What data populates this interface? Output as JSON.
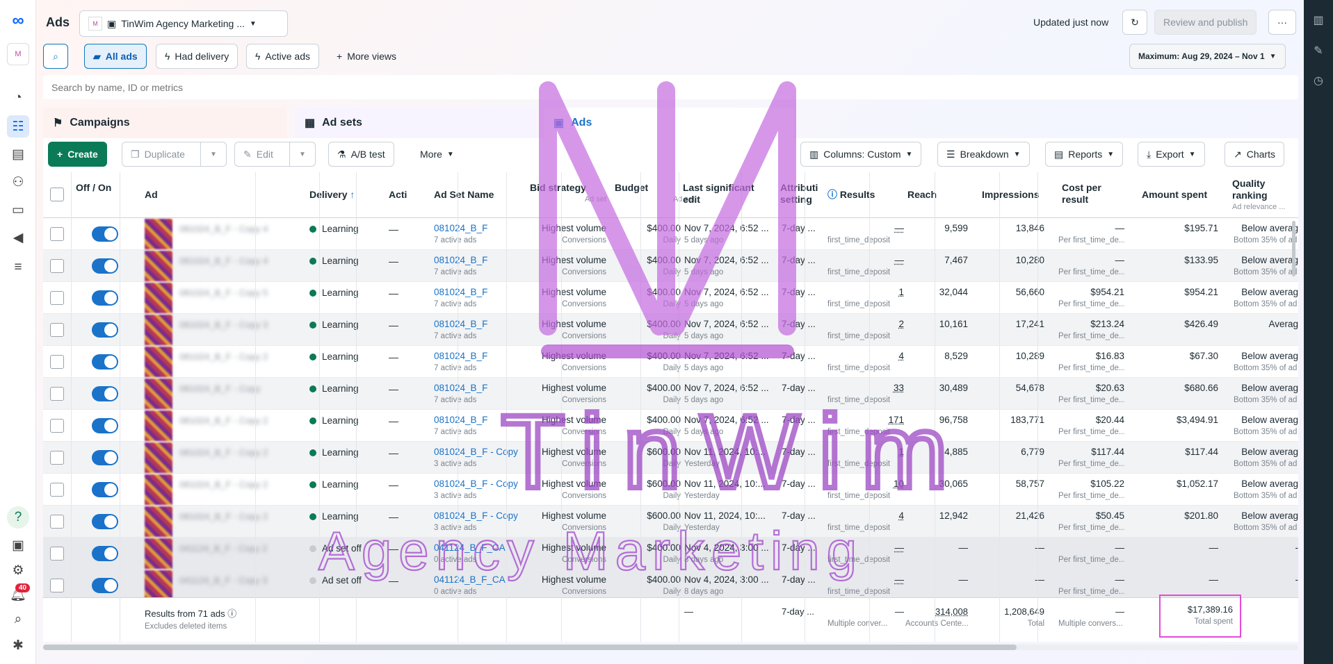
{
  "app": {
    "title": "Ads",
    "account": "TinWim Agency Marketing ...",
    "updated": "Updated just now",
    "review": "Review and publish",
    "more": "···"
  },
  "nav": {
    "notifications": "40"
  },
  "filters": {
    "all_ads": "All ads",
    "had_delivery": "Had delivery",
    "active_ads": "Active ads",
    "more_views": "More views",
    "date_range": "Maximum: Aug 29, 2024 – Nov 1"
  },
  "search": {
    "placeholder": "Search by name, ID or metrics"
  },
  "tabs": {
    "campaigns": "Campaigns",
    "adsets": "Ad sets",
    "ads": "Ads"
  },
  "toolbar": {
    "create": "Create",
    "duplicate": "Duplicate",
    "edit": "Edit",
    "abtest": "A/B test",
    "more": "More",
    "columns": "Columns: Custom",
    "breakdown": "Breakdown",
    "reports": "Reports",
    "export": "Export",
    "charts": "Charts"
  },
  "headers": {
    "offon": "Off / On",
    "ad": "Ad",
    "delivery": "Delivery",
    "actions": "Acti",
    "adset": "Ad Set Name",
    "bid": "Bid strategy",
    "bid_sub": "Ad set",
    "budget": "Budget",
    "budget_sub": "Ad set",
    "last_edit": "Last significant edit",
    "attrib": "Attribution setting",
    "results": "Results",
    "reach": "Reach",
    "impressions": "Impressions",
    "cpr": "Cost per result",
    "spent": "Amount spent",
    "quality": "Quality ranking",
    "quality_sub": "Ad relevance ..."
  },
  "rows": [
    {
      "name": "081024_B_F - Copy 4",
      "delivery": "Learning",
      "dstatus": "green",
      "adset": "081024_B_F",
      "adset_sub": "7 active ads",
      "bid": "Highest volume",
      "bid_sub": "Conversions",
      "budget": "$400.00",
      "budget_sub": "Daily",
      "edit": "Nov 7, 2024, 6:52 ...",
      "edit_sub": "5 days ago",
      "attrib": "7-day ...",
      "results": "—",
      "results_sub": "first_time_deposit",
      "reach": "9,599",
      "impr": "13,846",
      "cpr": "—",
      "cpr_sub": "Per first_time_de...",
      "spent": "$195.71",
      "quality": "Below averag",
      "quality_sub": "Bottom 35% of ad"
    },
    {
      "name": "081024_B_F - Copy 4",
      "delivery": "Learning",
      "dstatus": "green",
      "adset": "081024_B_F",
      "adset_sub": "7 active ads",
      "bid": "Highest volume",
      "bid_sub": "Conversions",
      "budget": "$400.00",
      "budget_sub": "Daily",
      "edit": "Nov 7, 2024, 6:52 ...",
      "edit_sub": "5 days ago",
      "attrib": "7-day ...",
      "results": "—",
      "results_sub": "first_time_deposit",
      "reach": "7,467",
      "impr": "10,280",
      "cpr": "—",
      "cpr_sub": "Per first_time_de...",
      "spent": "$133.95",
      "quality": "Below averag",
      "quality_sub": "Bottom 35% of ad"
    },
    {
      "name": "081024_B_F - Copy 5",
      "delivery": "Learning",
      "dstatus": "green",
      "adset": "081024_B_F",
      "adset_sub": "7 active ads",
      "bid": "Highest volume",
      "bid_sub": "Conversions",
      "budget": "$400.00",
      "budget_sub": "Daily",
      "edit": "Nov 7, 2024, 6:52 ...",
      "edit_sub": "5 days ago",
      "attrib": "7-day ...",
      "results": "1",
      "results_sub": "first_time_deposit",
      "reach": "32,044",
      "impr": "56,660",
      "cpr": "$954.21",
      "cpr_sub": "Per first_time_de...",
      "spent": "$954.21",
      "quality": "Below averag",
      "quality_sub": "Bottom 35% of ad"
    },
    {
      "name": "081024_B_F - Copy 3",
      "delivery": "Learning",
      "dstatus": "green",
      "adset": "081024_B_F",
      "adset_sub": "7 active ads",
      "bid": "Highest volume",
      "bid_sub": "Conversions",
      "budget": "$400.00",
      "budget_sub": "Daily",
      "edit": "Nov 7, 2024, 6:52 ...",
      "edit_sub": "5 days ago",
      "attrib": "7-day ...",
      "results": "2",
      "results_sub": "first_time_deposit",
      "reach": "10,161",
      "impr": "17,241",
      "cpr": "$213.24",
      "cpr_sub": "Per first_time_de...",
      "spent": "$426.49",
      "quality": "Averag",
      "quality_sub": ""
    },
    {
      "name": "081024_B_F - Copy 2",
      "delivery": "Learning",
      "dstatus": "green",
      "adset": "081024_B_F",
      "adset_sub": "7 active ads",
      "bid": "Highest volume",
      "bid_sub": "Conversions",
      "budget": "$400.00",
      "budget_sub": "Daily",
      "edit": "Nov 7, 2024, 6:52 ...",
      "edit_sub": "5 days ago",
      "attrib": "7-day ...",
      "results": "4",
      "results_sub": "first_time_deposit",
      "reach": "8,529",
      "impr": "10,289",
      "cpr": "$16.83",
      "cpr_sub": "Per first_time_de...",
      "spent": "$67.30",
      "quality": "Below averag",
      "quality_sub": "Bottom 35% of ad"
    },
    {
      "name": "081024_B_F - Copy",
      "delivery": "Learning",
      "dstatus": "green",
      "adset": "081024_B_F",
      "adset_sub": "7 active ads",
      "bid": "Highest volume",
      "bid_sub": "Conversions",
      "budget": "$400.00",
      "budget_sub": "Daily",
      "edit": "Nov 7, 2024, 6:52 ...",
      "edit_sub": "5 days ago",
      "attrib": "7-day ...",
      "results": "33",
      "results_sub": "first_time_deposit",
      "reach": "30,489",
      "impr": "54,678",
      "cpr": "$20.63",
      "cpr_sub": "Per first_time_de...",
      "spent": "$680.66",
      "quality": "Below averag",
      "quality_sub": "Bottom 35% of ad"
    },
    {
      "name": "081024_B_F - Copy 2",
      "delivery": "Learning",
      "dstatus": "green",
      "adset": "081024_B_F",
      "adset_sub": "7 active ads",
      "bid": "Highest volume",
      "bid_sub": "Conversions",
      "budget": "$400.00",
      "budget_sub": "Daily",
      "edit": "Nov 7, 2024, 6:52 ...",
      "edit_sub": "5 days ago",
      "attrib": "7-day ...",
      "results": "171",
      "results_sub": "first_time_deposit",
      "reach": "96,758",
      "impr": "183,771",
      "cpr": "$20.44",
      "cpr_sub": "Per first_time_de...",
      "spent": "$3,494.91",
      "quality": "Below averag",
      "quality_sub": "Bottom 35% of ad"
    },
    {
      "name": "081024_B_F - Copy 2",
      "delivery": "Learning",
      "dstatus": "green",
      "adset": "081024_B_F - Copy",
      "adset_sub": "3 active ads",
      "bid": "Highest volume",
      "bid_sub": "Conversions",
      "budget": "$600.00",
      "budget_sub": "Daily",
      "edit": "Nov 11, 2024, 10:...",
      "edit_sub": "Yesterday",
      "attrib": "7-day ...",
      "results": "1",
      "results_sub": "first_time_deposit",
      "reach": "4,885",
      "impr": "6,779",
      "cpr": "$117.44",
      "cpr_sub": "Per first_time_de...",
      "spent": "$117.44",
      "quality": "Below averag",
      "quality_sub": "Bottom 35% of ad"
    },
    {
      "name": "081024_B_F - Copy 2",
      "delivery": "Learning",
      "dstatus": "green",
      "adset": "081024_B_F - Copy",
      "adset_sub": "3 active ads",
      "bid": "Highest volume",
      "bid_sub": "Conversions",
      "budget": "$600.00",
      "budget_sub": "Daily",
      "edit": "Nov 11, 2024, 10:...",
      "edit_sub": "Yesterday",
      "attrib": "7-day ...",
      "results": "10",
      "results_sub": "first_time_deposit",
      "reach": "30,065",
      "impr": "58,757",
      "cpr": "$105.22",
      "cpr_sub": "Per first_time_de...",
      "spent": "$1,052.17",
      "quality": "Below averag",
      "quality_sub": "Bottom 35% of ad"
    },
    {
      "name": "081024_B_F - Copy 2",
      "delivery": "Learning",
      "dstatus": "green",
      "adset": "081024_B_F - Copy",
      "adset_sub": "3 active ads",
      "bid": "Highest volume",
      "bid_sub": "Conversions",
      "budget": "$600.00",
      "budget_sub": "Daily",
      "edit": "Nov 11, 2024, 10:...",
      "edit_sub": "Yesterday",
      "attrib": "7-day ...",
      "results": "4",
      "results_sub": "first_time_deposit",
      "reach": "12,942",
      "impr": "21,426",
      "cpr": "$50.45",
      "cpr_sub": "Per first_time_de...",
      "spent": "$201.80",
      "quality": "Below averag",
      "quality_sub": "Bottom 35% of ad"
    },
    {
      "name": "041124_B_F - Copy 2",
      "delivery": "Ad set off",
      "dstatus": "off",
      "adset": "041124_B_F_CA",
      "adset_sub": "0 active ads",
      "bid": "Highest volume",
      "bid_sub": "Conversions",
      "budget": "$400.00",
      "budget_sub": "Daily",
      "edit": "Nov 4, 2024, 3:00 ...",
      "edit_sub": "8 days ago",
      "attrib": "7-day ...",
      "results": "—",
      "results_sub": "first_time_deposit",
      "reach": "—",
      "impr": "—",
      "cpr": "—",
      "cpr_sub": "Per first_time_de...",
      "spent": "—",
      "quality": "-",
      "quality_sub": ""
    },
    {
      "name": "041124_B_F - Copy 3",
      "delivery": "Ad set off",
      "dstatus": "off",
      "adset": "041124_B_F_CA",
      "adset_sub": "0 active ads",
      "bid": "Highest volume",
      "bid_sub": "Conversions",
      "budget": "$400.00",
      "budget_sub": "Daily",
      "edit": "Nov 4, 2024, 3:00 ...",
      "edit_sub": "8 days ago",
      "attrib": "7-day ...",
      "results": "—",
      "results_sub": "first_time_deposit",
      "reach": "—",
      "impr": "—",
      "cpr": "—",
      "cpr_sub": "Per first_time_de...",
      "spent": "—",
      "quality": "-",
      "quality_sub": ""
    }
  ],
  "footer": {
    "results": "Results from 71 ads",
    "results_sub": "Excludes deleted items",
    "edit": "—",
    "attrib": "7-day ...",
    "res": "—",
    "res_sub": "Multiple conver...",
    "reach": "314,008",
    "reach_sub": "Accounts Cente...",
    "impr": "1,208,649",
    "impr_sub": "Total",
    "cpr": "—",
    "cpr_sub": "Multiple convers...",
    "spent": "$17,389.16",
    "spent_sub": "Total spent"
  },
  "watermark": {
    "line1": "TinWim",
    "line2": "Agency Marketing"
  },
  "colors": {
    "accent": "#1a73c9",
    "learning": "#0a7a57",
    "watermark": "#a64fd1",
    "highlight": "#e44ad8"
  }
}
